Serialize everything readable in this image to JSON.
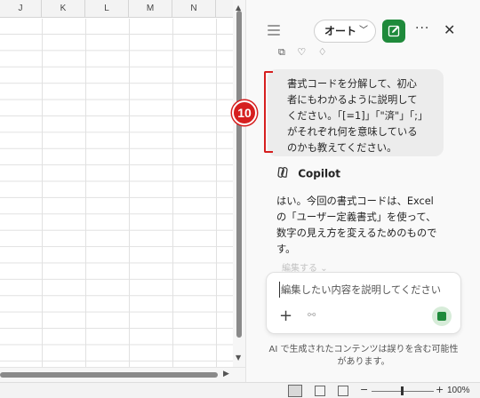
{
  "sheet": {
    "columns": [
      "J",
      "K",
      "L",
      "M",
      "N"
    ]
  },
  "pane": {
    "mode_label": "オート",
    "more_label": "···",
    "close_label": "✕",
    "user_message_lines": [
      "書式コードを分解して、初心",
      "者にもわかるように説明して",
      "ください。「[=1]」「\"済\"」「;」",
      "がそれぞれ何を意味している",
      "のかも教えてください。"
    ],
    "step_number": "10",
    "assistant_name": "Copilot",
    "assistant_message_lines": [
      "はい。今回の書式コードは、Excel",
      "の「ユーザー定義書式」を使って、",
      "数字の見え方を変えるためのもので",
      "す。"
    ],
    "edit_hint": "編集する",
    "composer_placeholder": "編集したい内容を説明してください",
    "disclaimer_lines": [
      "AI で生成されたコンテンツは誤りを含む可能性",
      "があります。"
    ]
  },
  "statusbar": {
    "zoom_level": "100%",
    "zoom_minus": "−",
    "zoom_plus": "+"
  },
  "colors": {
    "accent_green": "#1f8a3b",
    "annotation_red": "#d61f1f"
  }
}
